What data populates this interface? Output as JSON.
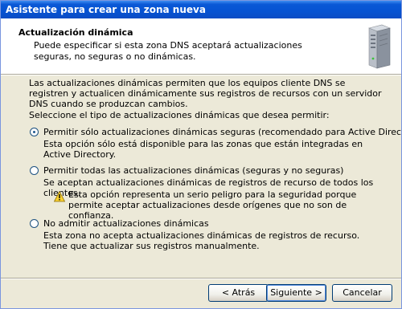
{
  "window": {
    "title": "Asistente para crear una zona nueva"
  },
  "header": {
    "title": "Actualización dinámica",
    "subtitle": "Puede especificar si esta zona DNS aceptará actualizaciones seguras, no seguras o no dinámicas.",
    "icon": "server-icon"
  },
  "body": {
    "intro": "Las actualizaciones dinámicas permiten que los equipos cliente DNS se registren y actualicen dinámicamente sus registros de recursos con un servidor DNS cuando se produzcan cambios.",
    "prompt": "Seleccione el tipo de actualizaciones dinámicas que desea permitir:"
  },
  "options": [
    {
      "label": "Permitir sólo actualizaciones dinámicas seguras (recomendado para Active Directory)",
      "description": "Esta opción sólo está disponible para las zonas que están integradas en Active Directory.",
      "selected": true
    },
    {
      "label": "Permitir todas las actualizaciones dinámicas (seguras y no seguras)",
      "description": "Se aceptan actualizaciones dinámicas de registros de recurso de todos los clientes.",
      "warning": "Esta opción representa un serio peligro para la seguridad porque permite aceptar actualizaciones desde orígenes que no son de confianza.",
      "selected": false
    },
    {
      "label": "No admitir actualizaciones dinámicas",
      "description": "Esta zona no acepta actualizaciones dinámicas de registros de recurso. Tiene que actualizar sus registros manualmente.",
      "selected": false
    }
  ],
  "buttons": {
    "back": "< Atrás",
    "next": "Siguiente >",
    "cancel": "Cancelar"
  },
  "colors": {
    "titlebar": "#0a58d6",
    "dialog_bg": "#ece9d8",
    "header_bg": "#ffffff",
    "warning_yellow": "#f8d030"
  }
}
